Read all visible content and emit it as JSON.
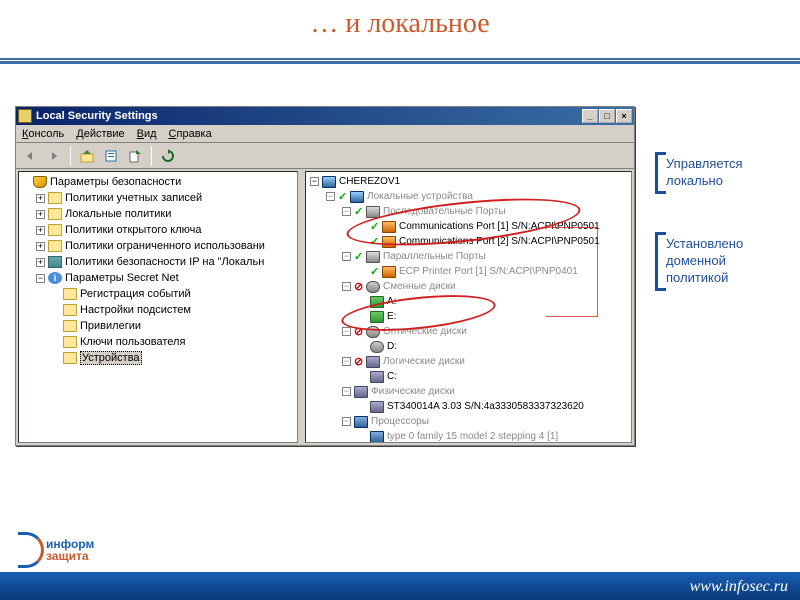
{
  "slide": {
    "title": "… и локальное"
  },
  "window": {
    "title": "Local Security Settings",
    "menu": {
      "console": "Консоль",
      "action": "Действие",
      "view": "Вид",
      "help": "Справка"
    },
    "controls": {
      "min": "_",
      "max": "□",
      "close": "×"
    }
  },
  "left_tree": {
    "root": "Параметры безопасности",
    "n1": "Политики учетных записей",
    "n2": "Локальные политики",
    "n3": "Политики открытого ключа",
    "n4": "Политики ограниченного использовани",
    "n5": "Политики безопасности IP на \"Локальн",
    "n6": "Параметры Secret Net",
    "n6a": "Регистрация событий",
    "n6b": "Настройки подсистем",
    "n6c": "Привилегии",
    "n6d": "Ключи пользователя",
    "n6e": "Устройства"
  },
  "right_tree": {
    "root": "CHEREZOV1",
    "g1": "Локальные устройства",
    "g1a": "Последовательные Порты",
    "g1a1": "Communications Port [1] S/N:ACPI\\PNP0501",
    "g1a2": "Communications Port [2] S/N:ACPI\\PNP0501",
    "g1b": "Параллельные Порты",
    "g1b1": "ECP Printer Port [1] S/N:ACPI\\PNP0401",
    "g1c": "Сменные диски",
    "g1c1": "A:",
    "g1c2": "E:",
    "g1d": "Оптические диски",
    "g1d1": "D:",
    "g1e": "Логические диски",
    "g1e1": "C:",
    "g1f": "Физические диски",
    "g1f1": "ST340014A 3.03 S/N:4a3330583337323620",
    "g1g": "Процессоры",
    "g1g1": "type 0 family 15 model 2 stepping 4 [1]"
  },
  "callouts": {
    "c1": "Управляется локально",
    "c2": "Установлено доменной политикой"
  },
  "footer": {
    "url": "www.infosec.ru",
    "logo1": "информ",
    "logo2": "защита"
  }
}
